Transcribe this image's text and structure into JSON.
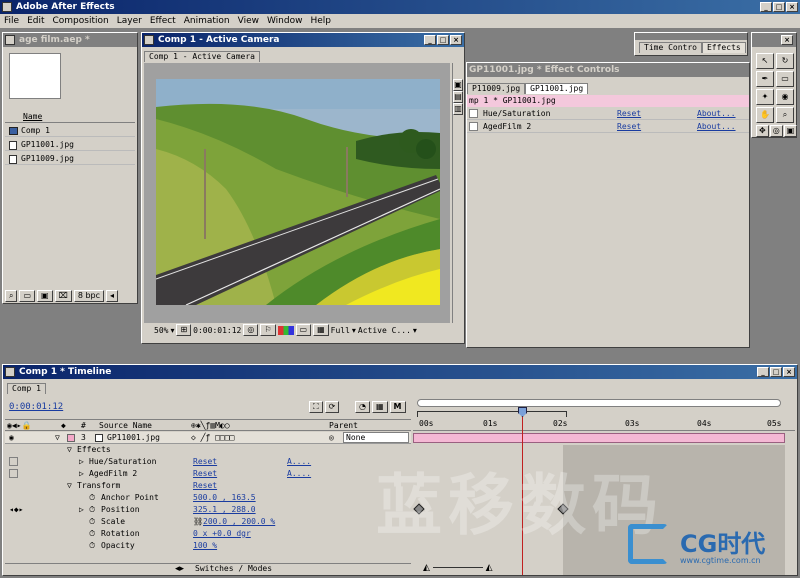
{
  "app": {
    "title": "Adobe After Effects"
  },
  "menu": [
    "File",
    "Edit",
    "Composition",
    "Layer",
    "Effect",
    "Animation",
    "View",
    "Window",
    "Help"
  ],
  "project": {
    "title": "age film.aep *",
    "col_name": "Name",
    "items": [
      "Comp 1",
      "GP11001.jpg",
      "GP11009.jpg"
    ],
    "bpc": "8 bpc"
  },
  "comp": {
    "title": "Comp 1 - Active Camera",
    "tab": "Comp 1 - Active Camera",
    "zoom": "50%",
    "time": "0:00:01:12",
    "quality": "Full",
    "view": "Active C..."
  },
  "palette_tabs": {
    "time_controls": "Time Contro",
    "effects": "Effects"
  },
  "effect_controls": {
    "title": "GP11001.jpg * Effect Controls",
    "tab1": "P11009.jpg",
    "tab2": "GP11001.jpg",
    "path": "mp 1 * GP11001.jpg",
    "effects": [
      {
        "name": "Hue/Saturation",
        "reset": "Reset",
        "about": "About..."
      },
      {
        "name": "AgedFilm 2",
        "reset": "Reset",
        "about": "About..."
      }
    ]
  },
  "timeline": {
    "title": "Comp 1 * Timeline",
    "tab": "Comp 1",
    "time": "0:00:01:12",
    "columns": {
      "num": "#",
      "source": "Source Name",
      "parent": "Parent"
    },
    "layer": {
      "num": "3",
      "name": "GP11001.jpg",
      "parent": "None"
    },
    "rows": {
      "effects": "Effects",
      "hue": "Hue/Saturation",
      "aged": "AgedFilm 2",
      "reset": "Reset",
      "adv": "A....",
      "transform": "Transform",
      "anchor": "Anchor Point",
      "anchor_val": "500.0 , 163.5",
      "position": "Position",
      "position_val": "325.1 , 288.0",
      "scale": "Scale",
      "scale_val": "200.0 , 200.0 %",
      "rotation": "Rotation",
      "rotation_val": "0 x +0.0 dgr",
      "opacity": "Opacity",
      "opacity_val": "100 %"
    },
    "ruler": [
      "00s",
      "01s",
      "02s",
      "03s",
      "04s",
      "05s"
    ],
    "switches": "Switches / Modes"
  },
  "watermark": {
    "text": "蓝移数码",
    "logo": "CG时代",
    "url": "www.cgtime.com.cn"
  }
}
